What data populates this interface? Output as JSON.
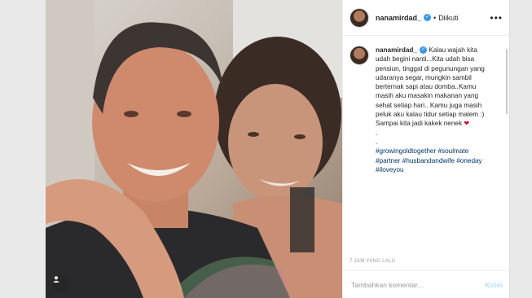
{
  "post": {
    "username": "nanamirdad_",
    "follow_status": "Diikuti",
    "more_icon": "more-horizontal-icon",
    "caption_lines": [
      "Kalau wajah kita",
      "udah begini nanti...Kita udah bisa",
      "pensiun, tinggal di pegunungan yang",
      "udaranya segar, mungkin sambil",
      "berternak sapi atau domba..Kamu",
      "masih aku masakin makanan yang",
      "sehat setiap hari.. Kamu juga masih",
      "peluk aku kalau tidur setiap malem :)",
      "Sampai kita jadi kakek nenek"
    ],
    "dots": [
      ".",
      "."
    ],
    "hashtags_lines": [
      "#growingoldtogether #soulmate",
      "#partner #husbandandwife #oneday",
      "#iloveyou"
    ],
    "timestamp": "7 JAM YANG LALU",
    "comment_placeholder": "Tambahkan komentar...",
    "send_label": "Kirim",
    "accent_color": "#3897f0",
    "heart_icon": "red-heart-emoji"
  }
}
